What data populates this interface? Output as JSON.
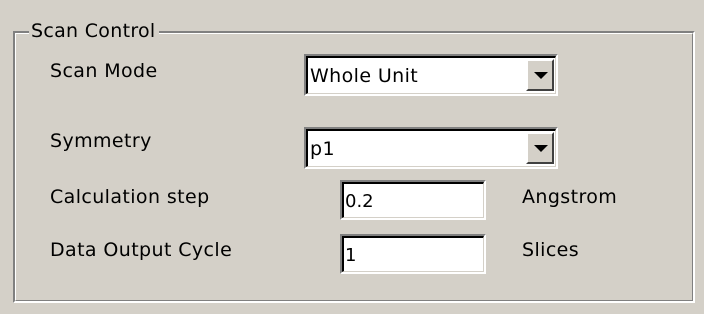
{
  "group": {
    "title": "Scan Control"
  },
  "scan_mode": {
    "label": "Scan Mode",
    "value": "Whole Unit"
  },
  "symmetry": {
    "label": "Symmetry",
    "value": "p1"
  },
  "calculation_step": {
    "label": "Calculation step",
    "value": "0.2",
    "unit": "Angstrom"
  },
  "data_output_cycle": {
    "label": "Data Output Cycle",
    "value": "1",
    "unit": "Slices"
  },
  "icons": {
    "dropdown": "chevron-down-icon"
  },
  "colors": {
    "dialog_background": "#d4d0c8",
    "field_background": "#ffffff"
  }
}
